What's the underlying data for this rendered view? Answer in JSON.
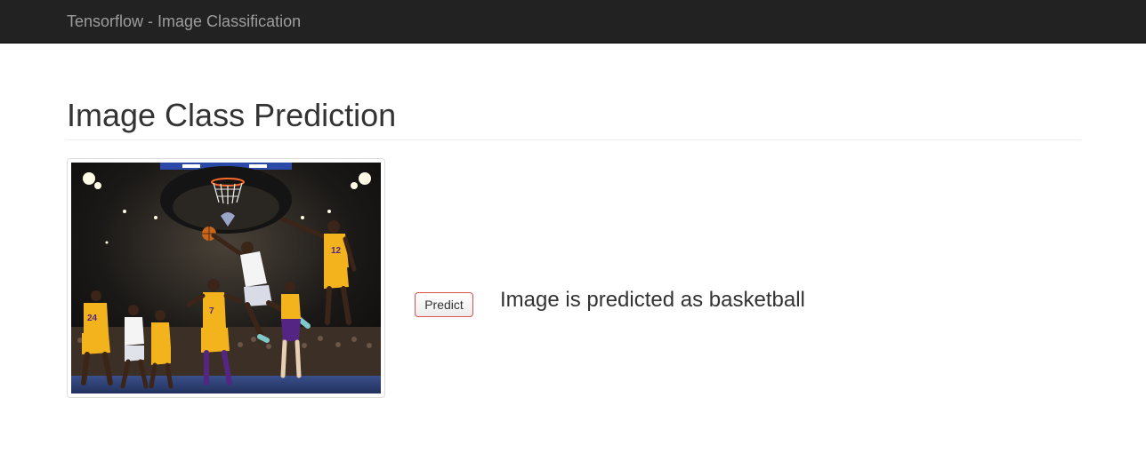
{
  "navbar": {
    "brand": "Tensorflow - Image Classification"
  },
  "header": {
    "title": "Image Class Prediction"
  },
  "image": {
    "subject": "basketball game photo",
    "jersey_numbers": [
      "24",
      "7",
      "12"
    ]
  },
  "actions": {
    "predict_label": "Predict"
  },
  "result": {
    "text": "Image is predicted as basketball"
  },
  "colors": {
    "navbar_bg": "#222222",
    "brand_text": "#9d9d9d",
    "button_border": "#d9534f",
    "jersey_gold": "#f2b31c",
    "jersey_purple": "#552583"
  }
}
